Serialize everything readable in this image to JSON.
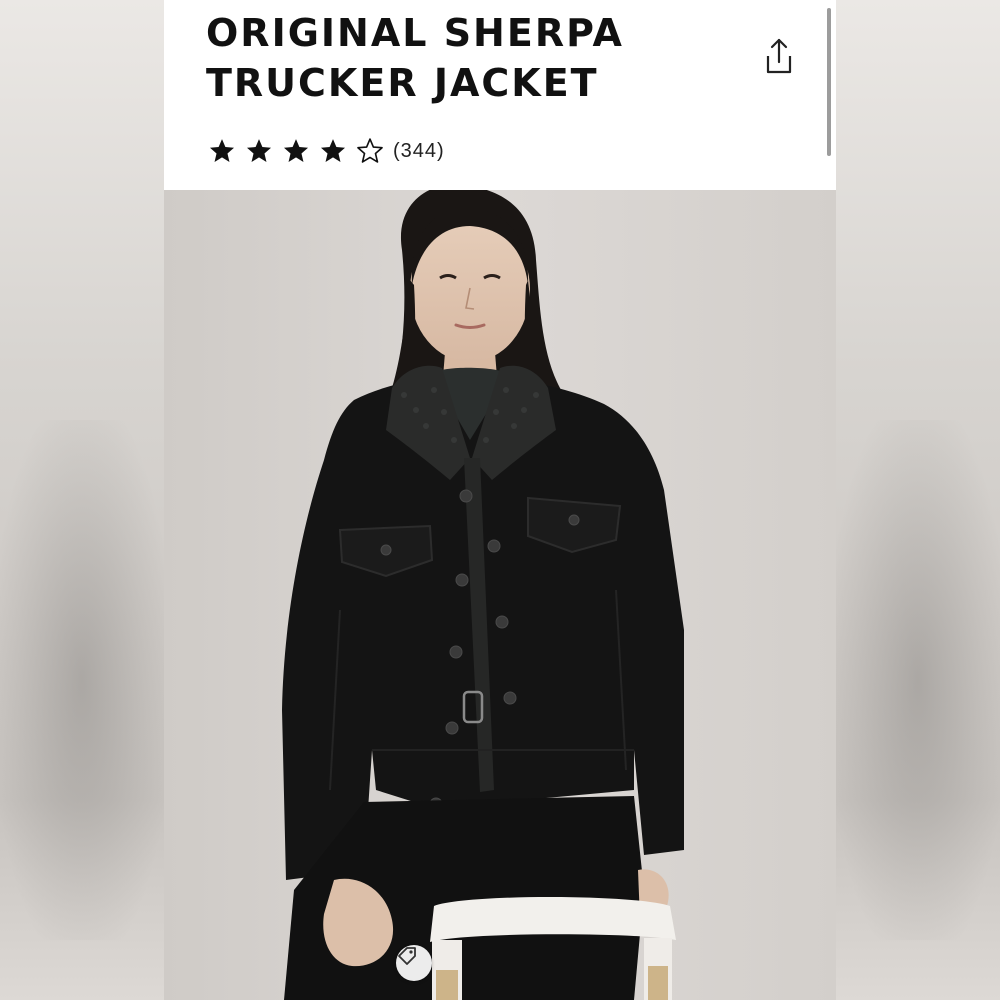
{
  "product": {
    "title_line1": "ORIGINAL SHERPA",
    "title_line2": "TRUCKER JACKET",
    "rating": {
      "value": 4.5,
      "max": 5,
      "count_label": "(344)"
    }
  },
  "icons": {
    "share": "share-icon",
    "star_full": "star-icon",
    "star_outline": "star-outline-icon",
    "tag": "price-tag-icon"
  },
  "colors": {
    "title": "#111111",
    "star": "#111111",
    "jacket": "#141414",
    "background": "#d9d6d2"
  }
}
